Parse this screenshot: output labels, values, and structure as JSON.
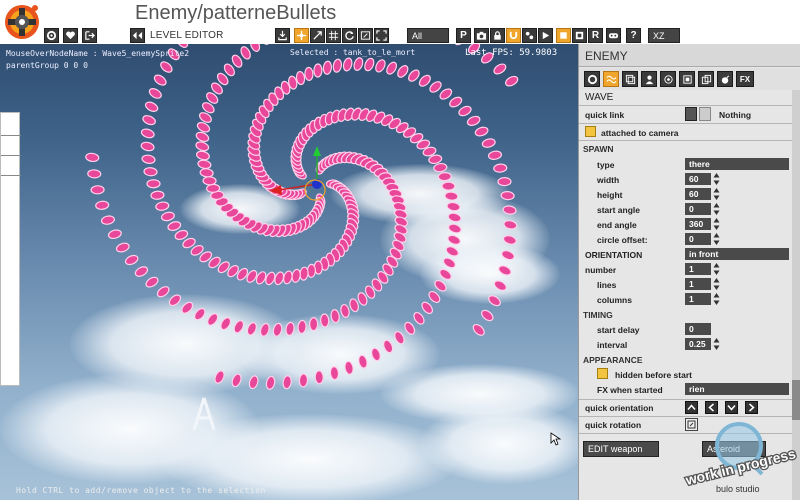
{
  "app": {
    "title": "Enemy/patterneBullets",
    "mode_label": "LEVEL EDITOR"
  },
  "toolbar": {
    "filter_value": "All",
    "letter_buttons": {
      "p": "P",
      "r": "R",
      "help": "?"
    },
    "axis_value": "XZ",
    "icons": [
      "settings-icon",
      "heart-icon",
      "exit-icon",
      "back-forward-icon",
      "export-icon",
      "move-icon",
      "scale-icon",
      "grid-icon",
      "rotate-icon",
      "window-icon",
      "camera-icon",
      "lock-icon",
      "magnet-icon",
      "bullets-icon",
      "play-icon",
      "stop-icon",
      "film-icon",
      "database-icon",
      "controller-icon",
      "help-icon"
    ]
  },
  "viewport": {
    "info_line1": "MouseOverNodeName : Wave5_enemySprite2",
    "info_line2": "parentGroup   0 0 0",
    "selected_info": "Selected : tank_to_le_mort",
    "fps_label": "Last FPS:",
    "fps_value": "59.9803",
    "hint": "Hold CTRL to add/remove object to the selection"
  },
  "panel": {
    "header": "ENEMY",
    "sub_header": "WAVE",
    "quick_link": {
      "label": "quick link",
      "value": "Nothing"
    },
    "attached": {
      "label": "attached to camera",
      "checked": true
    },
    "spawn": {
      "title": "SPAWN",
      "type": {
        "label": "type",
        "value": "there"
      },
      "width": {
        "label": "width",
        "value": "60"
      },
      "height": {
        "label": "height",
        "value": "60"
      },
      "start_angle": {
        "label": "start angle",
        "value": "0"
      },
      "end_angle": {
        "label": "end angle",
        "value": "360"
      },
      "circle_offset": {
        "label": "circle offset:",
        "value": "0"
      }
    },
    "orientation": {
      "label": "ORIENTATION",
      "value": "in front"
    },
    "number": {
      "title": "number",
      "count": "1",
      "lines": {
        "label": "lines",
        "value": "1"
      },
      "columns": {
        "label": "columns",
        "value": "1"
      }
    },
    "timing": {
      "title": "TIMING",
      "start_delay": {
        "label": "start delay",
        "value": "0"
      },
      "interval": {
        "label": "interval",
        "value": "0.25"
      }
    },
    "appearance": {
      "title": "APPEARANCE",
      "hidden": {
        "label": "hidden before start",
        "checked": true
      },
      "fx": {
        "label": "FX when started",
        "value": "rien"
      }
    },
    "quick_orientation": "quick orientation",
    "quick_rotation": "quick rotation",
    "edit_weapon": "EDIT weapon",
    "asteroid": "Asteroid"
  },
  "watermark": {
    "line1": "work in progress",
    "line2": "bulo studio"
  },
  "colors": {
    "accent": "#f0a52c",
    "bullet": "#e8479a",
    "sky_top": "#2f4d70"
  }
}
